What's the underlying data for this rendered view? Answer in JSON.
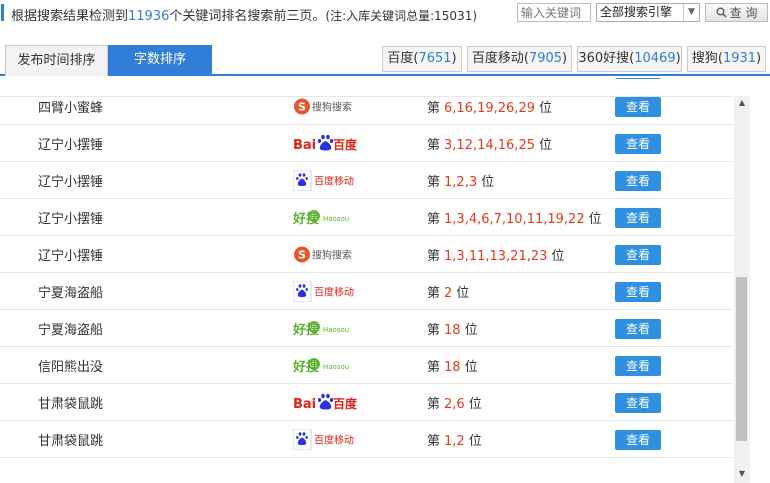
{
  "summary": {
    "prefix": "根据搜索结果检测到",
    "count": "11936",
    "suffix": "个关键词排名搜索前三页。",
    "total_text": "(注:入库关键词总量:15031)"
  },
  "search": {
    "placeholder": "输入关键词"
  },
  "engine_select": {
    "value": "全部搜索引擎"
  },
  "query_button": {
    "label": "查 询"
  },
  "tabs": [
    {
      "label": "发布时间排序"
    },
    {
      "label": "字数排序"
    }
  ],
  "engine_counts": [
    {
      "name": "百度",
      "count": "7651"
    },
    {
      "name": "百度移动",
      "count": "7905"
    },
    {
      "name": "360好搜",
      "count": "10469"
    },
    {
      "name": "搜狗",
      "count": "1931"
    }
  ],
  "logos": {
    "sogou": "搜狗搜索",
    "baidu_bai": "Bai",
    "baidu_du": "百度",
    "baidu_mobile": "百度移动",
    "haosou_cn": "好搜",
    "haosou_en": "Haosou"
  },
  "rank_prefix": "第",
  "rank_suffix": "位",
  "view_label": "查看",
  "rows": [
    {
      "keyword": "四臂小蜜蜂",
      "engine": "sogou",
      "ranks": "6,16,19,26,29"
    },
    {
      "keyword": "辽宁小摆锤",
      "engine": "baidu",
      "ranks": "3,12,14,16,25"
    },
    {
      "keyword": "辽宁小摆锤",
      "engine": "baidu_mobile",
      "ranks": "1,2,3"
    },
    {
      "keyword": "辽宁小摆锤",
      "engine": "haosou",
      "ranks": "1,3,4,6,7,10,11,19,22"
    },
    {
      "keyword": "辽宁小摆锤",
      "engine": "sogou",
      "ranks": "1,3,11,13,21,23"
    },
    {
      "keyword": "宁夏海盗船",
      "engine": "baidu_mobile",
      "ranks": "2"
    },
    {
      "keyword": "宁夏海盗船",
      "engine": "haosou",
      "ranks": "18"
    },
    {
      "keyword": "信阳熊出没",
      "engine": "haosou",
      "ranks": "18"
    },
    {
      "keyword": "甘肃袋鼠跳",
      "engine": "baidu",
      "ranks": "2,6"
    },
    {
      "keyword": "甘肃袋鼠跳",
      "engine": "baidu_mobile",
      "ranks": "1,2"
    }
  ],
  "colors": {
    "accent": "#2f7ed8",
    "rank": "#e03c1a",
    "button": "#2f8fe0"
  }
}
